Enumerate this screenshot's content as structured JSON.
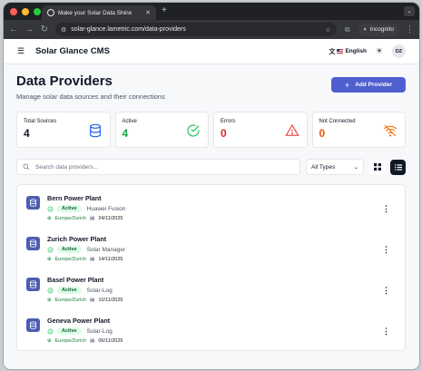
{
  "browser": {
    "tab_title": "Make your Solar Data Shine",
    "url": "solar-glance.lametric.com/data-providers",
    "incognito_label": "Incognito"
  },
  "app": {
    "brand": "Solar Glance CMS",
    "language": "English",
    "avatar_initials": "DZ"
  },
  "page": {
    "title": "Data Providers",
    "subtitle": "Manage solar data sources and their connections",
    "add_button": "Add Provider"
  },
  "stats": [
    {
      "label": "Total Sources",
      "value": "4",
      "color": "#111827",
      "icon": "database-icon",
      "icon_color": "#2563eb"
    },
    {
      "label": "Active",
      "value": "4",
      "color": "#16a34a",
      "icon": "check-circle-icon",
      "icon_color": "#22c55e"
    },
    {
      "label": "Errors",
      "value": "0",
      "color": "#dc2626",
      "icon": "warning-triangle-icon",
      "icon_color": "#ef4444"
    },
    {
      "label": "Not Connected",
      "value": "0",
      "color": "#ea580c",
      "icon": "wifi-off-icon",
      "icon_color": "#f97316"
    }
  ],
  "filters": {
    "search_placeholder": "Search data providers...",
    "type_selected": "All Types"
  },
  "providers": [
    {
      "name": "Bern Power Plant",
      "status": "Active",
      "vendor": "Huawei Fusion",
      "timezone": "Europe/Zurich",
      "date": "24/11/2025"
    },
    {
      "name": "Zurich Power Plant",
      "status": "Active",
      "vendor": "Solar Manager",
      "timezone": "Europe/Zurich",
      "date": "14/11/2025"
    },
    {
      "name": "Basel Power Plant",
      "status": "Active",
      "vendor": "Solar-Log",
      "timezone": "Europe/Zurich",
      "date": "10/11/2025"
    },
    {
      "name": "Geneva Power Plant",
      "status": "Active",
      "vendor": "Solar-Log",
      "timezone": "Europe/Zurich",
      "date": "06/11/2025"
    }
  ]
}
